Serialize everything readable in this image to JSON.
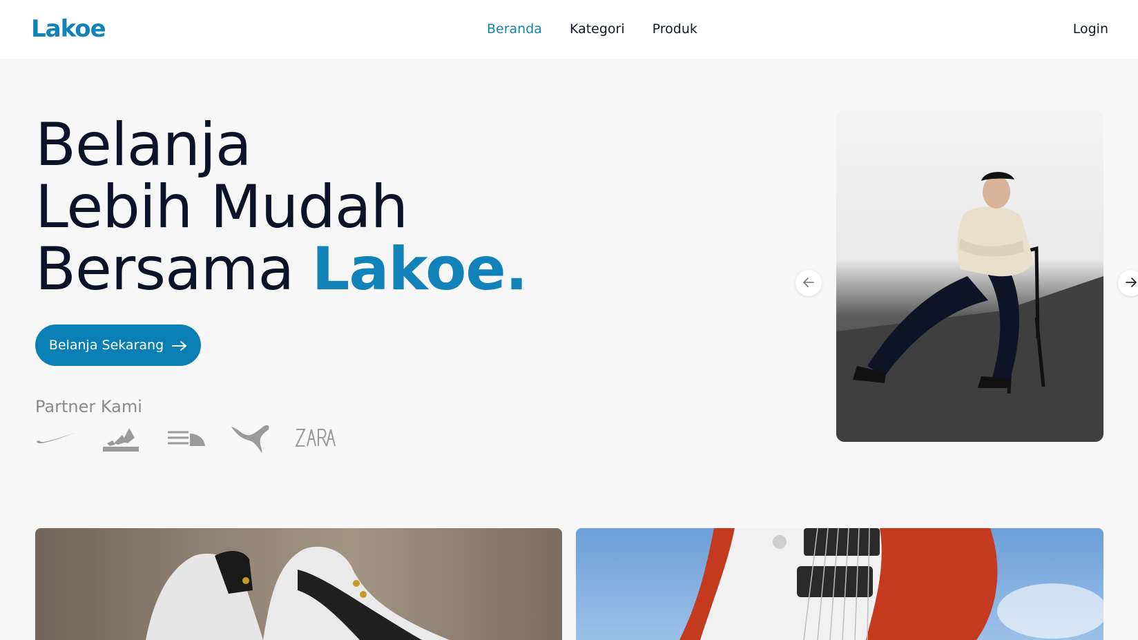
{
  "header": {
    "logo": "Lakoe",
    "nav": [
      {
        "label": "Beranda",
        "active": true
      },
      {
        "label": "Kategori",
        "active": false
      },
      {
        "label": "Produk",
        "active": false
      }
    ],
    "login_label": "Login"
  },
  "hero": {
    "line1": "Belanja",
    "line2": "Lebih Mudah",
    "line3_prefix": "Bersama",
    "line3_brand": "Lakoe.",
    "cta_label": "Belanja Sekarang",
    "partner_heading": "Partner Kami",
    "partners": [
      "nike-logo",
      "adidas-logo",
      "the-north-face-logo",
      "puma-logo",
      "zara-logo"
    ]
  },
  "colors": {
    "accent": "#1183b8",
    "cta": "#0a7fb5",
    "text": "#0c1228",
    "background": "#f7f7f7"
  }
}
